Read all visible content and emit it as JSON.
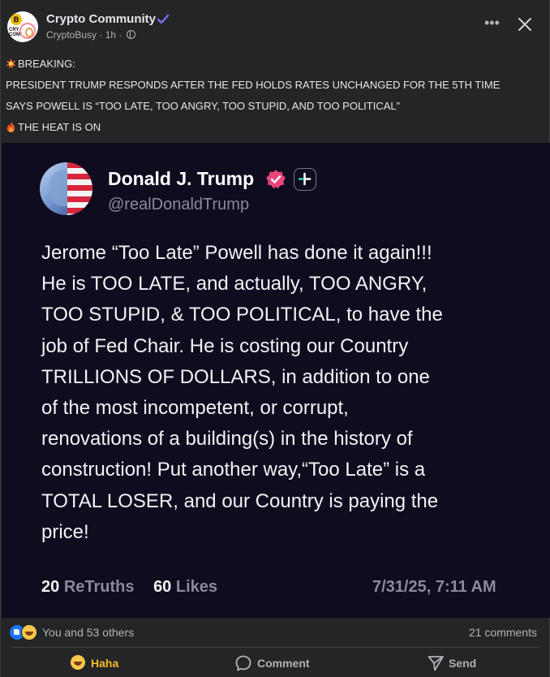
{
  "post": {
    "page_name": "Crypto Community",
    "author": "CryptoBusy",
    "time": "1h",
    "separator": "·",
    "avatar_text": "CRY\nCOM",
    "avatar_coin": "B"
  },
  "caption": {
    "line1": "BREAKING:",
    "line2": "PRESIDENT TRUMP RESPONDS AFTER THE FED HOLDS RATES UNCHANGED FOR THE 5TH TIME",
    "line3": "SAYS POWELL IS “TOO LATE, TOO ANGRY, TOO STUPID, AND TOO POLITICAL”",
    "line4": "THE HEAT IS ON"
  },
  "truth": {
    "name": "Donald J. Trump",
    "handle": "@realDonaldTrump",
    "body_lines": [
      "Jerome “Too Late” Powell has done it again!!!",
      "He is TOO LATE, and actually, TOO ANGRY,",
      "TOO STUPID, & TOO POLITICAL, to have the",
      "job of Fed Chair. He is costing our Country",
      "TRILLIONS OF DOLLARS, in addition to one",
      "of the most incompetent, or corrupt,",
      "renovations of a building(s) in the history of",
      "construction! Put another way,“Too Late” is a",
      "TOTAL LOSER, and our Country is paying the",
      "price!"
    ],
    "retruths_count": "20",
    "retruths_label": "ReTruths",
    "likes_count": "60",
    "likes_label": "Likes",
    "date": "7/31/25, 7:11 AM"
  },
  "engagement": {
    "reactions_text": "You and 53 others",
    "comments_text": "21 comments"
  },
  "actions": {
    "haha": "Haha",
    "comment": "Comment",
    "send": "Send"
  },
  "colors": {
    "background": "#242526",
    "image_background": "#0e0c1e",
    "verified": "#7b6cf6",
    "haha_active": "#f7b928",
    "like_blue": "#1877f2"
  },
  "icons": [
    "verified-badge-icon",
    "globe-icon",
    "more-icon",
    "close-icon",
    "explosion-emoji-icon",
    "fire-emoji-icon",
    "truth-verified-icon",
    "truth-plus-icon",
    "like-reaction-icon",
    "haha-reaction-icon",
    "comment-icon",
    "send-icon"
  ]
}
